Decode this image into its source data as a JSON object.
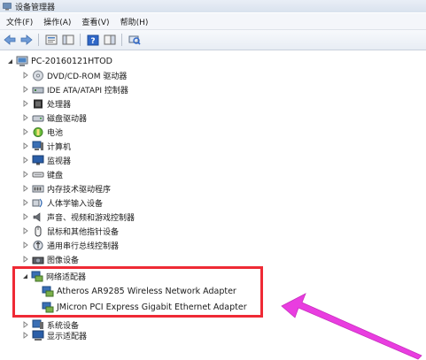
{
  "window": {
    "title": "设备管理器"
  },
  "menu": [
    "文件(F)",
    "操作(A)",
    "查看(V)",
    "帮助(H)"
  ],
  "toolbar": {
    "buttons": [
      "back-arrow-icon",
      "forward-arrow-icon",
      "properties-icon",
      "console-tree-icon",
      "help-icon",
      "action-pane-icon",
      "scan-hardware-icon"
    ]
  },
  "tree": {
    "root": "PC-20160121HTOD",
    "categories": [
      "DVD/CD-ROM 驱动器",
      "IDE ATA/ATAPI 控制器",
      "处理器",
      "磁盘驱动器",
      "电池",
      "计算机",
      "监视器",
      "键盘",
      "内存技术驱动程序",
      "人体学输入设备",
      "声音、视频和游戏控制器",
      "鼠标和其他指针设备",
      "通用串行总线控制器",
      "图像设备",
      "网络适配器",
      "系统设备",
      "显示适配器"
    ],
    "network_children": [
      "Atheros AR9285 Wireless Network Adapter",
      "JMicron PCI Express Gigabit Ethernet Adapter"
    ]
  },
  "colors": {
    "highlight": "#ef2a35",
    "arrow": "#e93de0"
  }
}
